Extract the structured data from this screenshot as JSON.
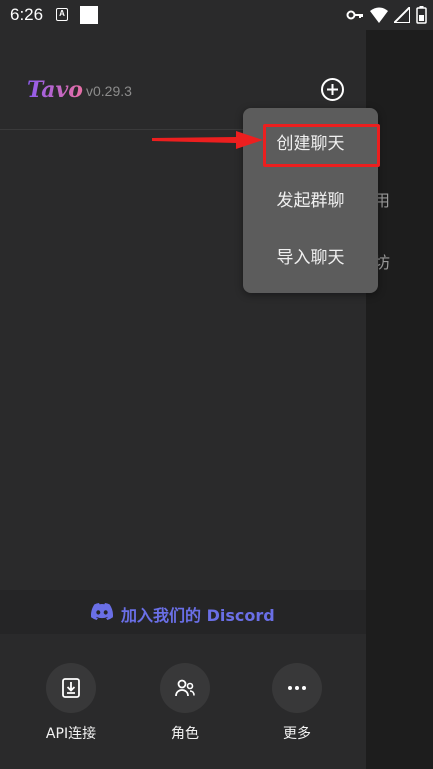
{
  "status_bar": {
    "time": "6:26",
    "a_glyph": "A"
  },
  "header": {
    "logo": "Tavo",
    "version": "v0.29.3"
  },
  "popup_menu": {
    "items": [
      "创建聊天",
      "发起群聊",
      "导入聊天"
    ]
  },
  "background_fragments": [
    "用",
    "坊"
  ],
  "discord": {
    "label": "加入我们的 Discord"
  },
  "bottom_nav": {
    "items": [
      {
        "label": "API连接",
        "icon": "import-icon"
      },
      {
        "label": "角色",
        "icon": "people-icon"
      },
      {
        "label": "更多",
        "icon": "more-icon"
      }
    ]
  },
  "colors": {
    "highlight": "#ec1f1f",
    "discord": "#6a6fe6"
  }
}
